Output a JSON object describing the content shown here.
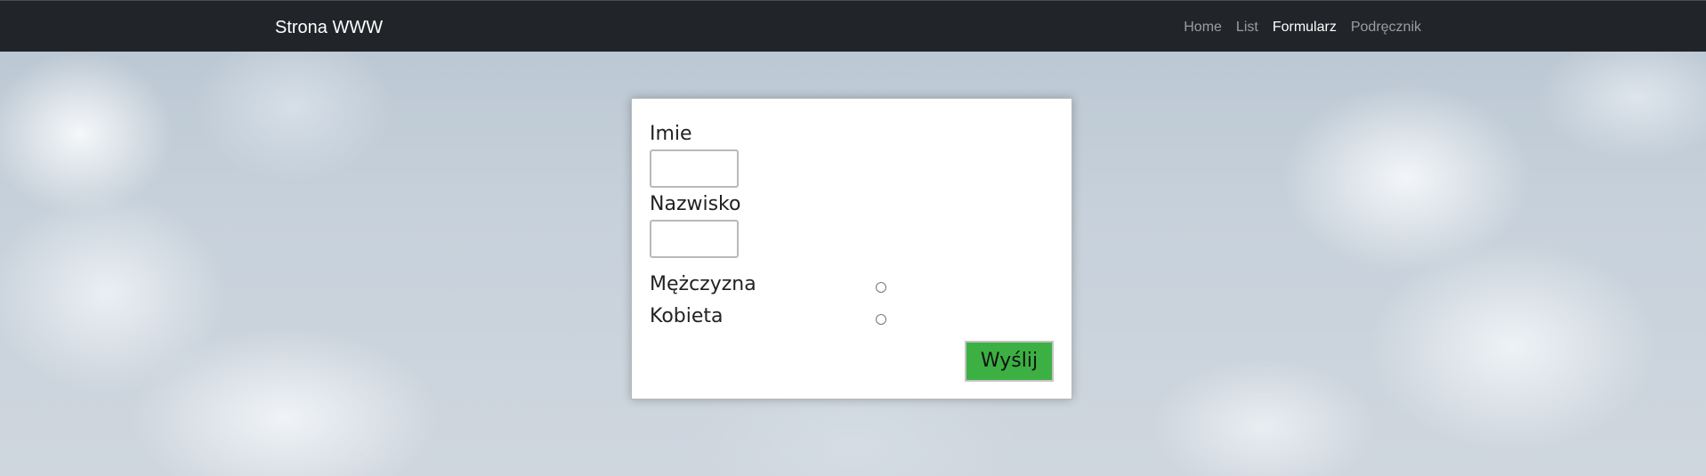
{
  "navbar": {
    "brand": "Strona WWW",
    "links": [
      {
        "label": "Home",
        "active": false
      },
      {
        "label": "List",
        "active": false
      },
      {
        "label": "Formularz",
        "active": true
      },
      {
        "label": "Podręcznik",
        "active": false
      }
    ]
  },
  "form": {
    "first_name": {
      "label": "Imie",
      "value": ""
    },
    "last_name": {
      "label": "Nazwisko",
      "value": ""
    },
    "gender": {
      "options": [
        {
          "label": "Mężczyzna",
          "checked": false
        },
        {
          "label": "Kobieta",
          "checked": false
        }
      ]
    },
    "submit_label": "Wyślij"
  },
  "colors": {
    "navbar_bg": "#212529",
    "submit_bg": "#3cb043",
    "card_bg": "#ffffff"
  }
}
